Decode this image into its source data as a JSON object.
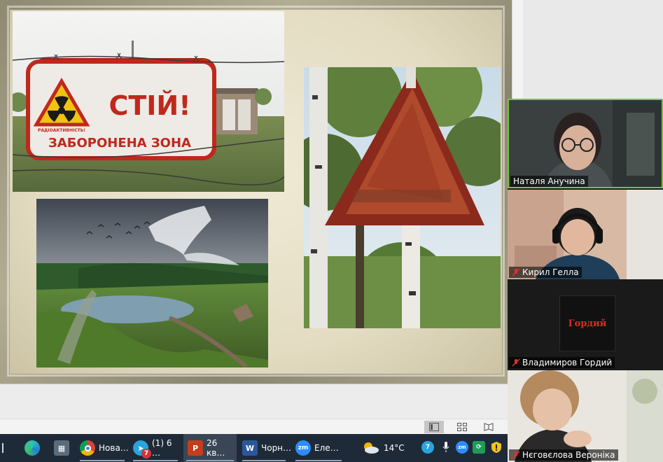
{
  "slide": {
    "sign1_line1": "СТІЙ!",
    "sign1_line2": "ЗАБОРОНЕНА ЗОНА",
    "sign1_small": "РАДІОАКТИВНІСТЬ!"
  },
  "view_bar": {
    "normal_icon": "normal-view-icon",
    "sorter_icon": "slide-sorter-icon",
    "reading_icon": "reading-view-icon"
  },
  "taskbar": {
    "items": [
      {
        "label": "Нова…",
        "icon": "chrome-icon"
      },
      {
        "label": "(1) 6 …",
        "icon": "telegram-icon",
        "badge": "7"
      },
      {
        "label": "26 кв…",
        "icon": "powerpoint-icon"
      },
      {
        "label": "Чорн…",
        "icon": "word-icon"
      },
      {
        "label": "Еле…",
        "icon": "zoom-icon"
      }
    ],
    "weather": "14°C",
    "tray_badge": "7"
  },
  "participants": [
    {
      "name": "Наталя Анучина",
      "muted": false
    },
    {
      "name": "Кирил Гелла",
      "muted": true
    },
    {
      "name": "Владимиров Гордий",
      "muted": true,
      "avatar_text": "Гордий"
    },
    {
      "name": "Нєговєлова Вероніка",
      "muted": true
    }
  ],
  "colors": {
    "taskbar_bg": "#1f2a38",
    "active_speaker": "#7ec04a",
    "muted_red": "#e0302e",
    "avatar_red": "#e02828"
  }
}
